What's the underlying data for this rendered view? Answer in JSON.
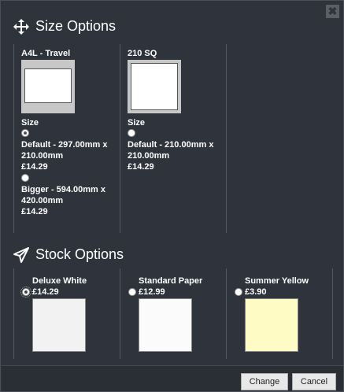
{
  "dialog": {
    "close_label": "✖"
  },
  "size_section": {
    "title": "Size Options",
    "icon": "move-arrows-icon",
    "products": [
      {
        "name": "A4L - Travel",
        "size_label": "Size",
        "options": [
          {
            "desc_line1": "Default - 297.00mm x",
            "desc_line2": "210.00mm",
            "price": "£14.29",
            "selected": true
          },
          {
            "desc_line1": "Bigger - 594.00mm x",
            "desc_line2": "420.00mm",
            "price": "£14.29",
            "selected": false
          }
        ]
      },
      {
        "name": "210 SQ",
        "size_label": "Size",
        "options": [
          {
            "desc_line1": "Default - 210.00mm x",
            "desc_line2": "210.00mm",
            "price": "£14.29",
            "selected": false
          }
        ]
      }
    ]
  },
  "stock_section": {
    "title": "Stock Options",
    "icon": "paper-plane-icon",
    "stocks": [
      {
        "name": "Deluxe White",
        "price": "£14.29",
        "color": "#f2f2f2",
        "selected": true
      },
      {
        "name": "Standard Paper",
        "price": "£12.99",
        "color": "#fbfbfb",
        "selected": false
      },
      {
        "name": "Summer Yellow",
        "price": "£3.90",
        "color": "#fefbc4",
        "selected": false
      }
    ]
  },
  "footer": {
    "change_label": "Change",
    "cancel_label": "Cancel"
  }
}
